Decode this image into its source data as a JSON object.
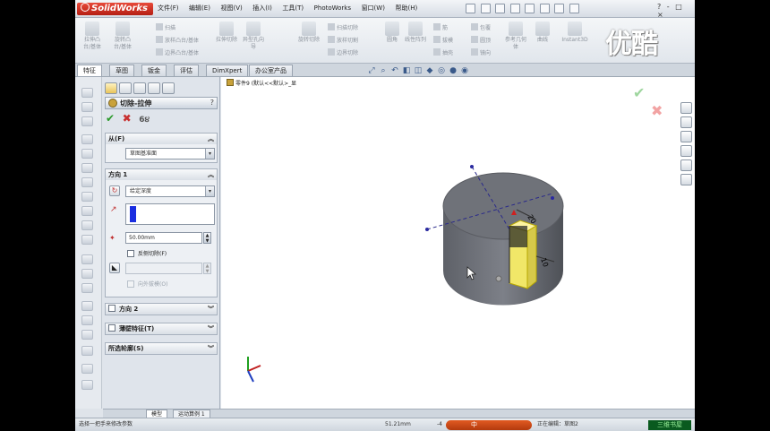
{
  "app": {
    "logo_text": "SolidWorks",
    "menu": [
      "文件(F)",
      "编辑(E)",
      "视图(V)",
      "插入(I)",
      "工具(T)",
      "PhotoWorks",
      "窗口(W)",
      "帮助(H)"
    ],
    "window_buttons": [
      "?",
      "-",
      "□",
      "×"
    ]
  },
  "watermark": "优酷",
  "ribbon": {
    "big_buttons": [
      "拉伸凸台/基体",
      "旋转凸台/基体",
      "拉伸切除",
      "异型孔向导",
      "旋转切除",
      "圆角",
      "线性阵列",
      "参考几何体",
      "曲线",
      "Instant3D"
    ],
    "small_rows": [
      [
        "扫描",
        "放样凸台/基体",
        "边界凸台/基体"
      ],
      [
        "扫描切除",
        "放样切割",
        "边界切除"
      ],
      [
        "筋",
        "拔模",
        "抽壳"
      ],
      [
        "包覆",
        "圆顶",
        "镜向"
      ]
    ]
  },
  "tabs": [
    "特征",
    "草图",
    "钣金",
    "评估",
    "DimXpert",
    "办公室产品"
  ],
  "property_manager": {
    "title": "切除-拉伸",
    "help": "?",
    "ok": "✔",
    "cancel": "✖",
    "from": {
      "header": "从(F)",
      "value": "草图基准面"
    },
    "direction1": {
      "header": "方向 1",
      "end_condition": "给定深度",
      "depth": "50.00mm",
      "flip_side_label": "反侧切除(F)",
      "draft_outward_label": "向外拔模(O)"
    },
    "collapsed_groups": [
      "方向 2",
      "薄壁特征(T)",
      "所选轮廓(S)"
    ]
  },
  "viewport": {
    "feature_tree_text": "零件9 (默认<<默认>_显"
  },
  "bottom_tabs": [
    "模型",
    "运动算例 1"
  ],
  "status": {
    "message": "选择一把手来修改参数",
    "coord": "51.21mm",
    "coord2": "-4",
    "ime_text": "中",
    "editing": "正在编辑：草图2",
    "brand": "三维书屋"
  }
}
